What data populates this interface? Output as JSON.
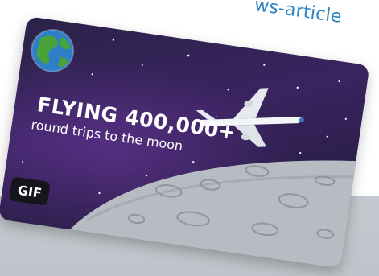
{
  "page": {
    "url_fragment": "ws-article"
  },
  "card": {
    "headline": "FLYING 400,000+",
    "subline": "round trips to the moon",
    "badge": "GIF",
    "icons": [
      "earth-icon",
      "airplane-icon"
    ]
  },
  "colors": {
    "card_background": "#2d1f4c",
    "moon_surface": "#b7bcc3",
    "url_text": "#2a83c4",
    "badge_background": "#16151d"
  }
}
